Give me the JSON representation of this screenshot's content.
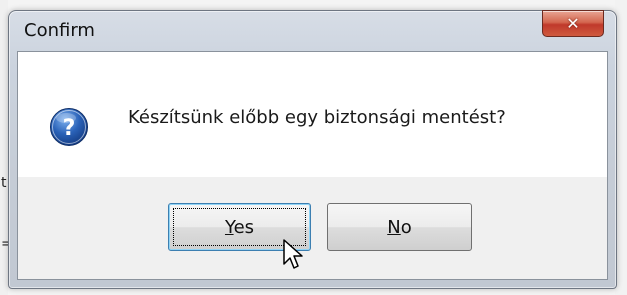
{
  "background": {
    "left_glyphs": [
      "t",
      "="
    ]
  },
  "dialog": {
    "title": "Confirm",
    "close_icon": "close-icon",
    "message": "Készítsünk előbb egy biztonsági mentést?",
    "icon": "question-icon",
    "buttons": {
      "yes": {
        "mnemonic": "Y",
        "rest": "es"
      },
      "no": {
        "mnemonic": "N",
        "rest": "o"
      }
    },
    "focused_button": "yes"
  },
  "colors": {
    "accent_close": "#c0392b",
    "question_icon": "#2a62b8",
    "focus_border": "#3c7fb1"
  }
}
